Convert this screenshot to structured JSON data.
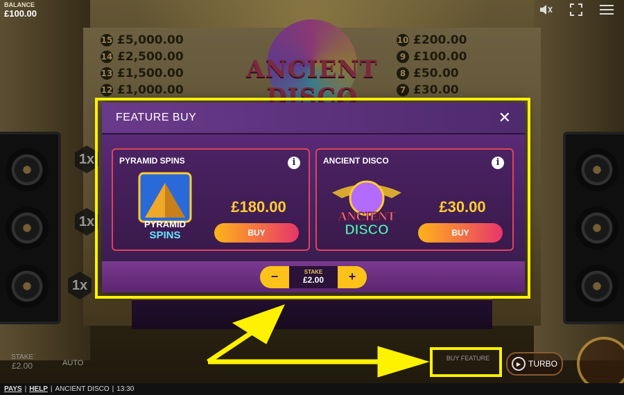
{
  "balance": {
    "label": "BALANCE",
    "value": "£100.00"
  },
  "top_icons": [
    "sound-muted-icon",
    "fullscreen-icon",
    "menu-icon"
  ],
  "game_logo": "ANCIENT DISCO",
  "paytable": {
    "left": [
      {
        "n": "15",
        "v": "£5,000.00"
      },
      {
        "n": "14",
        "v": "£2,500.00"
      },
      {
        "n": "13",
        "v": "£1,500.00"
      },
      {
        "n": "12",
        "v": "£1,000.00"
      }
    ],
    "right": [
      {
        "n": "10",
        "v": "£200.00"
      },
      {
        "n": "9",
        "v": "£100.00"
      },
      {
        "n": "8",
        "v": "£50.00"
      },
      {
        "n": "7",
        "v": "£30.00"
      }
    ]
  },
  "multipliers": [
    "1x",
    "1x",
    "1x"
  ],
  "feature_buy": {
    "title": "FEATURE BUY",
    "close": "✕",
    "cards": [
      {
        "name": "PYRAMID SPINS",
        "art_text_1": "PYRAMID",
        "art_text_2": "SPINS",
        "price": "£180.00",
        "buy": "BUY"
      },
      {
        "name": "ANCIENT DISCO",
        "art_text_1": "ANCIENT",
        "art_text_2": "DISCO",
        "price": "£30.00",
        "buy": "BUY"
      }
    ],
    "stake": {
      "label": "STAKE",
      "value": "£2.00",
      "minus": "−",
      "plus": "+"
    }
  },
  "bottom": {
    "stake_label": "STAKE",
    "stake_value": "£2.00",
    "auto": "AUTO",
    "buy_feature": "BUY FEATURE",
    "turbo": "TURBO"
  },
  "footer": {
    "pays": "PAYS",
    "help": "HELP",
    "game": "ANCIENT DISCO",
    "time": "13:30",
    "sep": "|"
  },
  "colors": {
    "highlight": "#fff200",
    "price": "#ffcc33",
    "buy_start": "#ffb31a",
    "buy_end": "#e8356b",
    "card_border": "#e0435c"
  }
}
